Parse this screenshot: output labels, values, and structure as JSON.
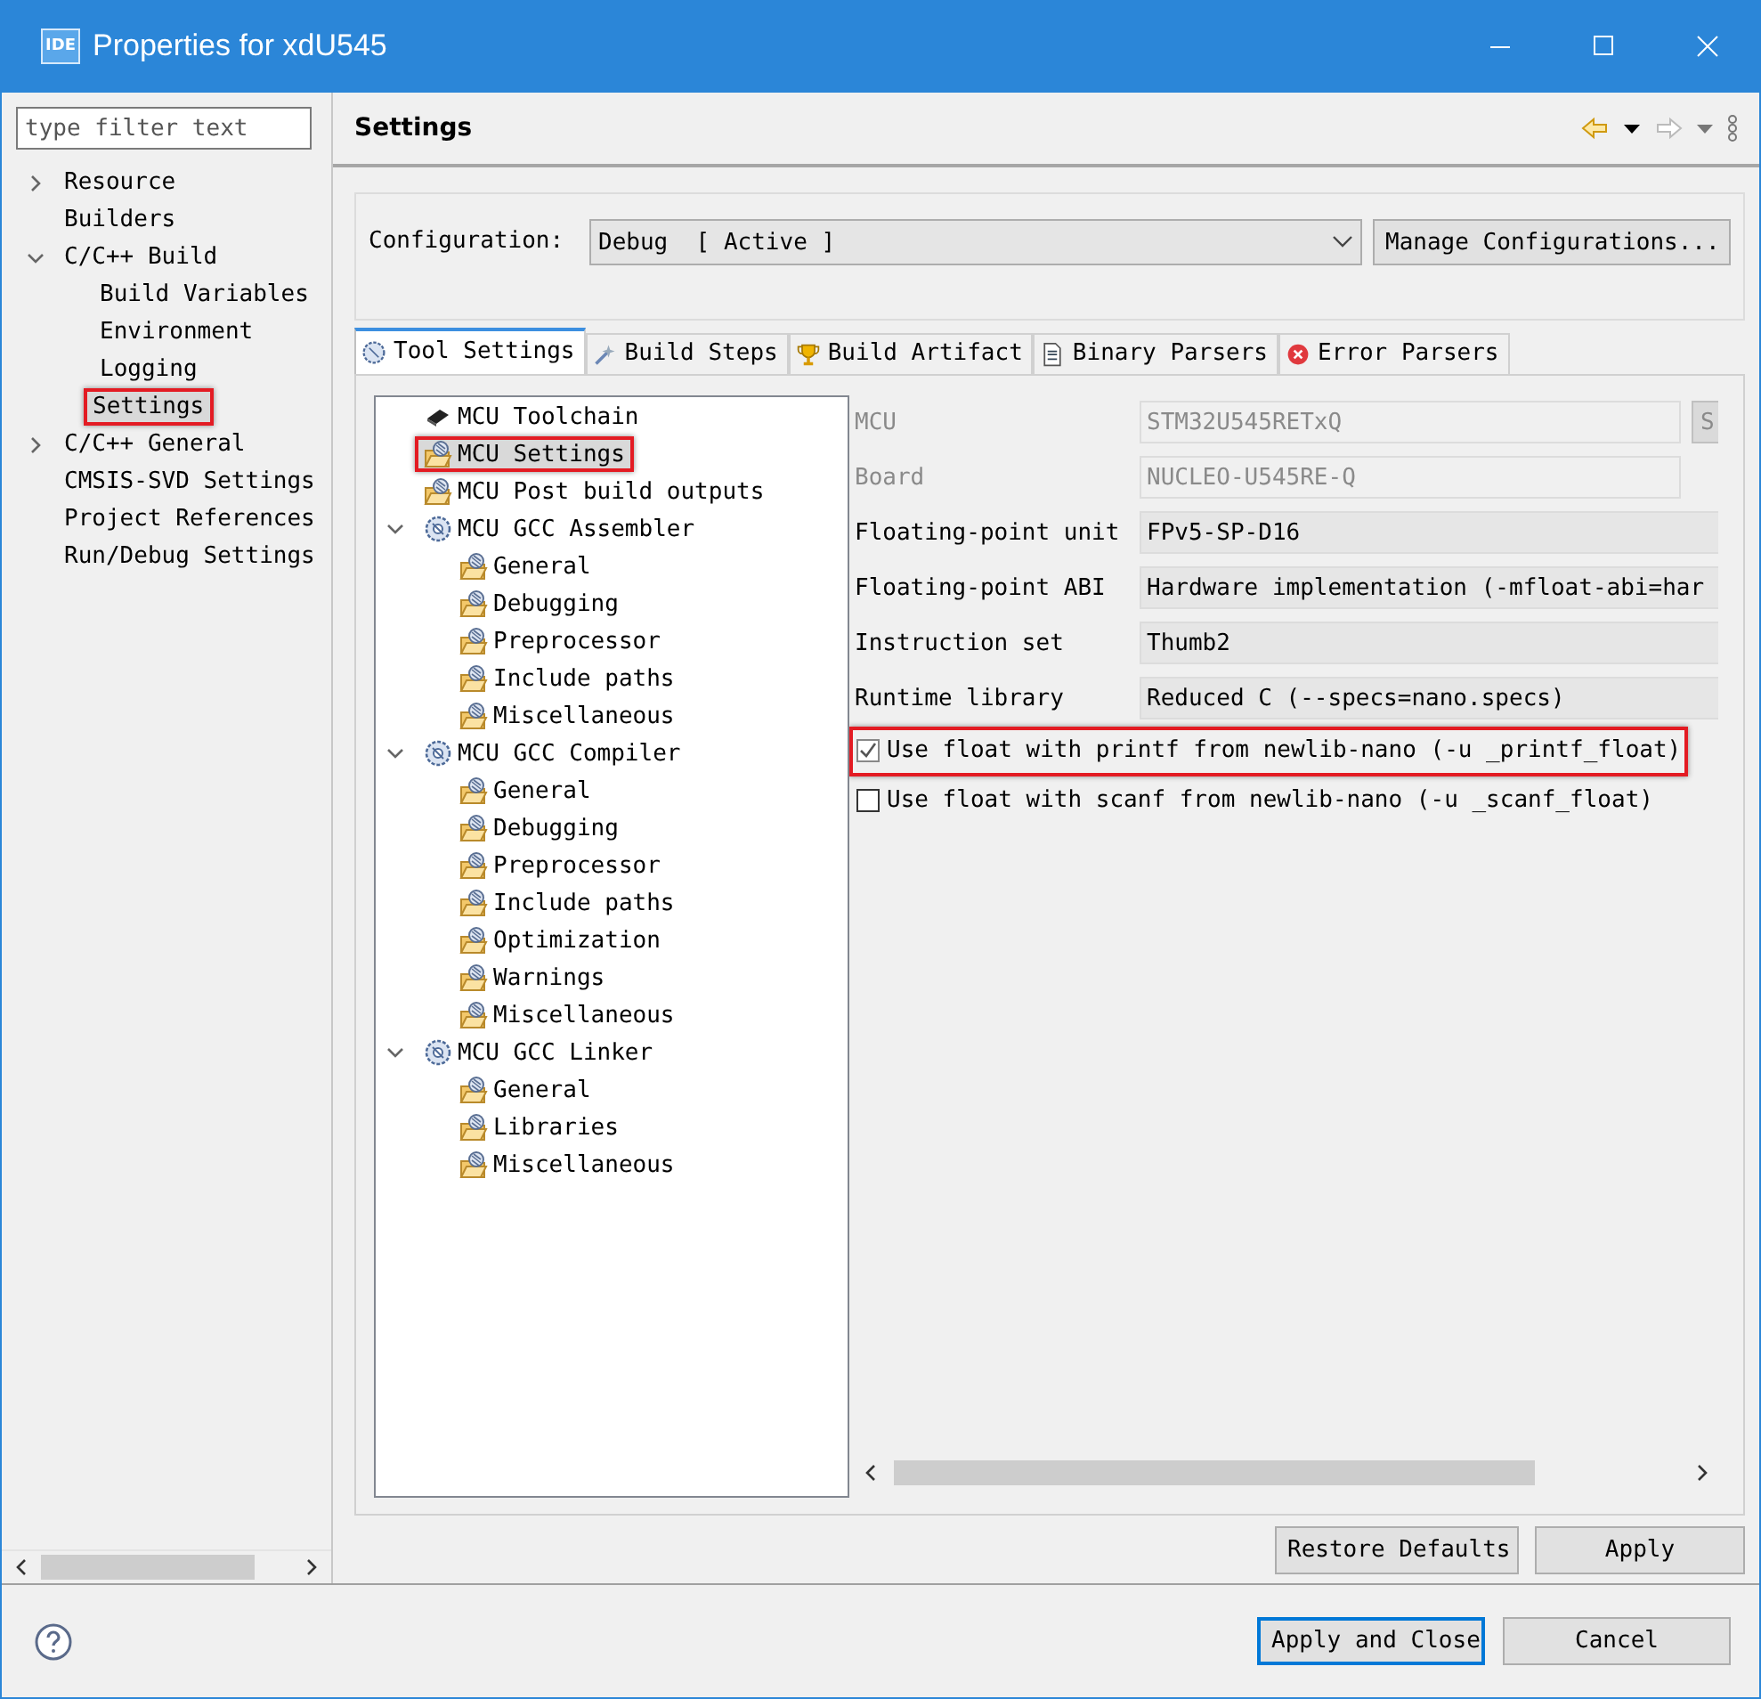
{
  "window": {
    "app_icon": "IDE",
    "title": "Properties for xdU545"
  },
  "sidebar": {
    "filter": {
      "placeholder": "type filter text"
    },
    "items": [
      {
        "label": "Resource",
        "expanded": false,
        "selected": false,
        "highlighted": false
      },
      {
        "label": "Builders",
        "selected": false,
        "highlighted": false
      },
      {
        "label": "C/C++ Build",
        "expanded": true,
        "selected": false,
        "highlighted": false,
        "children": [
          {
            "label": "Build Variables",
            "selected": false,
            "highlighted": false
          },
          {
            "label": "Environment",
            "selected": false,
            "highlighted": false
          },
          {
            "label": "Logging",
            "selected": false,
            "highlighted": false
          },
          {
            "label": "Settings",
            "selected": true,
            "highlighted": true
          }
        ]
      },
      {
        "label": "C/C++ General",
        "expanded": false,
        "selected": false,
        "highlighted": false
      },
      {
        "label": "CMSIS-SVD Settings",
        "selected": false,
        "highlighted": false
      },
      {
        "label": "Project References",
        "selected": false,
        "highlighted": false
      },
      {
        "label": "Run/Debug Settings",
        "selected": false,
        "highlighted": false
      }
    ]
  },
  "page": {
    "title": "Settings"
  },
  "configuration": {
    "label": "Configuration:",
    "value": "Debug  [ Active ]",
    "button": "Manage Configurations..."
  },
  "tabs": [
    {
      "label": "Tool Settings",
      "kind": "gear",
      "selected": true
    },
    {
      "label": "Build Steps",
      "kind": "wand",
      "selected": false
    },
    {
      "label": "Build Artifact",
      "kind": "trophy",
      "selected": false
    },
    {
      "label": "Binary Parsers",
      "kind": "binary",
      "selected": false
    },
    {
      "label": "Error Parsers",
      "kind": "error",
      "selected": false
    }
  ],
  "tool_tree": [
    {
      "label": "MCU Toolchain",
      "kind": "chip",
      "selected": false,
      "highlighted": false
    },
    {
      "label": "MCU Settings",
      "kind": "option",
      "selected": true,
      "highlighted": true
    },
    {
      "label": "MCU Post build outputs",
      "kind": "option",
      "selected": false,
      "highlighted": false
    },
    {
      "label": "MCU GCC Assembler",
      "kind": "tool",
      "expanded": true,
      "selected": false,
      "highlighted": false,
      "children": [
        {
          "label": "General",
          "kind": "option",
          "selected": false,
          "highlighted": false
        },
        {
          "label": "Debugging",
          "kind": "option",
          "selected": false,
          "highlighted": false
        },
        {
          "label": "Preprocessor",
          "kind": "option",
          "selected": false,
          "highlighted": false
        },
        {
          "label": "Include paths",
          "kind": "option",
          "selected": false,
          "highlighted": false
        },
        {
          "label": "Miscellaneous",
          "kind": "option",
          "selected": false,
          "highlighted": false
        }
      ]
    },
    {
      "label": "MCU GCC Compiler",
      "kind": "tool",
      "expanded": true,
      "selected": false,
      "highlighted": false,
      "children": [
        {
          "label": "General",
          "kind": "option",
          "selected": false,
          "highlighted": false
        },
        {
          "label": "Debugging",
          "kind": "option",
          "selected": false,
          "highlighted": false
        },
        {
          "label": "Preprocessor",
          "kind": "option",
          "selected": false,
          "highlighted": false
        },
        {
          "label": "Include paths",
          "kind": "option",
          "selected": false,
          "highlighted": false
        },
        {
          "label": "Optimization",
          "kind": "option",
          "selected": false,
          "highlighted": false
        },
        {
          "label": "Warnings",
          "kind": "option",
          "selected": false,
          "highlighted": false
        },
        {
          "label": "Miscellaneous",
          "kind": "option",
          "selected": false,
          "highlighted": false
        }
      ]
    },
    {
      "label": "MCU GCC Linker",
      "kind": "tool",
      "expanded": true,
      "selected": false,
      "highlighted": false,
      "children": [
        {
          "label": "General",
          "kind": "option",
          "selected": false,
          "highlighted": false
        },
        {
          "label": "Libraries",
          "kind": "option",
          "selected": false,
          "highlighted": false
        },
        {
          "label": "Miscellaneous",
          "kind": "option",
          "selected": false,
          "highlighted": false
        }
      ]
    }
  ],
  "settings": [
    {
      "kind": "text",
      "label": "MCU",
      "value": "STM32U545RETxQ",
      "disabled": true,
      "button": "S"
    },
    {
      "kind": "text",
      "label": "Board",
      "value": "NUCLEO-U545RE-Q",
      "disabled": true
    },
    {
      "kind": "select",
      "label": "Floating-point unit",
      "value": "FPv5-SP-D16",
      "disabled": false
    },
    {
      "kind": "select",
      "label": "Floating-point ABI",
      "value": "Hardware implementation (-mfloat-abi=har",
      "disabled": false
    },
    {
      "kind": "select",
      "label": "Instruction set",
      "value": "Thumb2",
      "disabled": false
    },
    {
      "kind": "select",
      "label": "Runtime library",
      "value": "Reduced C (--specs=nano.specs)",
      "disabled": false
    },
    {
      "kind": "checkbox",
      "label": "Use float with printf from newlib-nano (-u _printf_float)",
      "checked": true,
      "highlighted": true
    },
    {
      "kind": "checkbox",
      "label": "Use float with scanf from newlib-nano (-u _scanf_float)",
      "checked": false,
      "highlighted": false
    }
  ],
  "page_buttons": [
    "Restore Defaults",
    "Apply"
  ],
  "dialog_buttons": [
    {
      "label": "Apply and Close",
      "default": true
    },
    {
      "label": "Cancel",
      "default": false
    }
  ]
}
